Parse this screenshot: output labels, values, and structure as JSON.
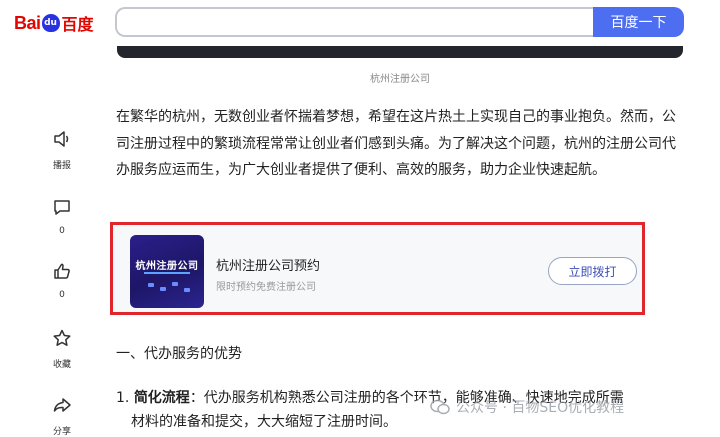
{
  "header": {
    "logo": {
      "part1": "Bai",
      "paw": "du",
      "part2": "百度"
    },
    "search_placeholder": "",
    "search_button": "百度一下"
  },
  "image_caption": "杭州注册公司",
  "rail": {
    "broadcast": "播报",
    "comment_count": "0",
    "like_count": "0",
    "favorite": "收藏",
    "share": "分享"
  },
  "article": {
    "intro": "在繁华的杭州，无数创业者怀揣着梦想，希望在这片热土上实现自己的事业抱负。然而，公司注册过程中的繁琐流程常常让创业者们感到头痛。为了解决这个问题，杭州的注册公司代办服务应运而生，为广大创业者提供了便利、高效的服务，助力企业快速起航。",
    "section_title": "一、代办服务的优势",
    "list": [
      {
        "number": "1.",
        "title": "简化流程",
        "text": "：代办服务机构熟悉公司注册的各个环节，能够准确、快速地完成所需",
        "cont": "材料的准备和提交，大大缩短了注册时间。"
      }
    ]
  },
  "card": {
    "thumb_title": "杭州注册公司",
    "title": "杭州注册公司预约",
    "subtitle": "限时预约免费注册公司",
    "button": "立即拨打",
    "highlight_color": "#e1262b"
  },
  "watermark": "公众号 · 百物SEO优化教程",
  "colors": {
    "brand_blue": "#4e6ef2",
    "logo_red": "#e10601"
  }
}
